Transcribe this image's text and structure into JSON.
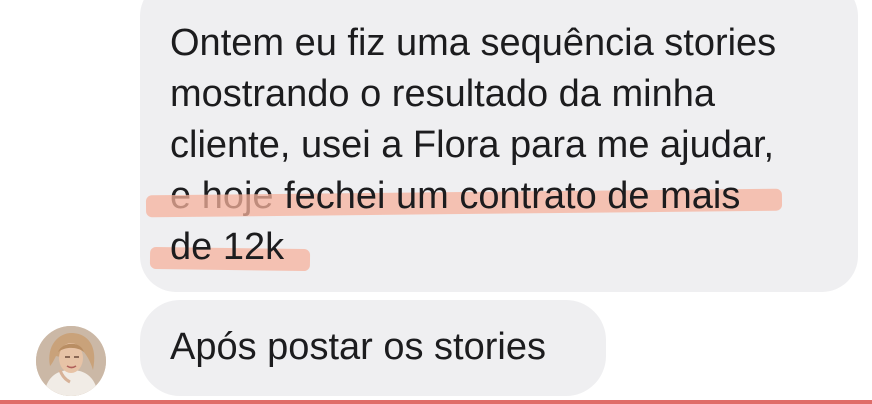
{
  "conversation": {
    "messages": [
      {
        "lines": [
          "Ontem eu fiz uma sequência stories",
          "mostrando o resultado da minha",
          "cliente, usei a Flora para me ajudar,",
          "e hoje ",
          "fechei um contrato de mais",
          "de 12k"
        ],
        "highlighted_text": "fechei um contrato de mais de 12k",
        "highlight_color": "#f6b29c"
      },
      {
        "text": "Após postar os stories"
      }
    ],
    "sender_avatar": {
      "icon": "user-avatar-photo"
    },
    "bubble_color": "#efeff1",
    "text_color": "#1c1c1e"
  }
}
